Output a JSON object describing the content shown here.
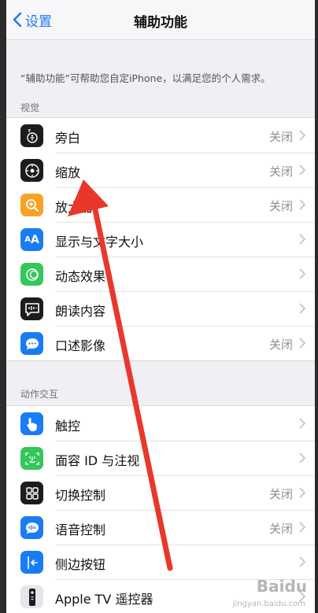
{
  "nav": {
    "back_label": "设置",
    "title": "辅助功能"
  },
  "intro": "“辅助功能”可帮助您自定iPhone，以满足您的个人需求。",
  "sections": {
    "vision": {
      "header": "视觉",
      "items": [
        {
          "label": "旁白",
          "value": "关闭",
          "icon": "voiceover-icon"
        },
        {
          "label": "缩放",
          "value": "关闭",
          "icon": "zoom-icon"
        },
        {
          "label": "放大器",
          "value": "关闭",
          "icon": "magnifier-icon"
        },
        {
          "label": "显示与文字大小",
          "value": "",
          "icon": "text-size-icon"
        },
        {
          "label": "动态效果",
          "value": "",
          "icon": "motion-icon"
        },
        {
          "label": "朗读内容",
          "value": "",
          "icon": "speech-icon"
        },
        {
          "label": "口述影像",
          "value": "关闭",
          "icon": "audio-description-icon"
        }
      ]
    },
    "interaction": {
      "header": "动作交互",
      "items": [
        {
          "label": "触控",
          "value": "",
          "icon": "touch-icon"
        },
        {
          "label": "面容 ID 与注视",
          "value": "",
          "icon": "face-id-icon"
        },
        {
          "label": "切换控制",
          "value": "关闭",
          "icon": "switch-control-icon"
        },
        {
          "label": "语音控制",
          "value": "关闭",
          "icon": "voice-control-icon"
        },
        {
          "label": "侧边按钮",
          "value": "",
          "icon": "side-button-icon"
        },
        {
          "label": "Apple TV 遥控器",
          "value": "",
          "icon": "tv-remote-icon"
        }
      ]
    }
  },
  "annotation": {
    "arrow_color": "#e8382b"
  },
  "watermark": {
    "brand": "Baidu",
    "sub": "jingyan.baidu.com"
  }
}
